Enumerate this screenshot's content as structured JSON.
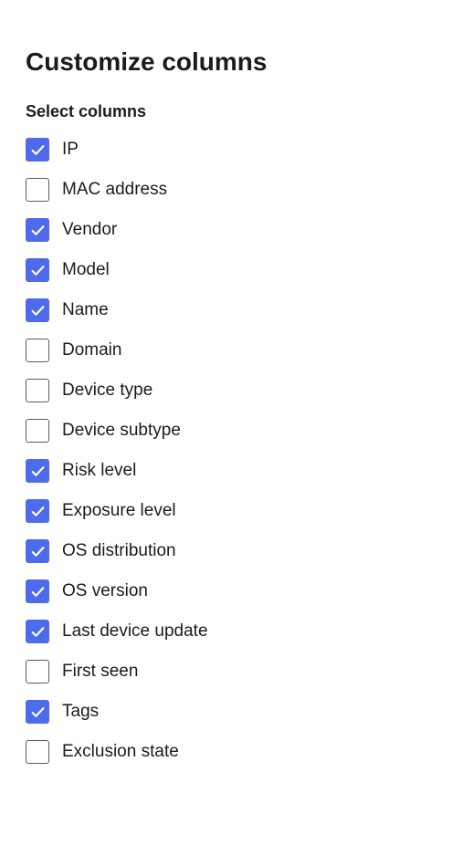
{
  "title": "Customize columns",
  "subtitle": "Select columns",
  "options": [
    {
      "label": "IP",
      "checked": true
    },
    {
      "label": "MAC address",
      "checked": false
    },
    {
      "label": "Vendor",
      "checked": true
    },
    {
      "label": "Model",
      "checked": true
    },
    {
      "label": "Name",
      "checked": true
    },
    {
      "label": "Domain",
      "checked": false
    },
    {
      "label": "Device type",
      "checked": false
    },
    {
      "label": "Device subtype",
      "checked": false
    },
    {
      "label": "Risk level",
      "checked": true
    },
    {
      "label": "Exposure level",
      "checked": true
    },
    {
      "label": "OS distribution",
      "checked": true
    },
    {
      "label": "OS version",
      "checked": true
    },
    {
      "label": "Last device update",
      "checked": true
    },
    {
      "label": "First seen",
      "checked": false
    },
    {
      "label": "Tags",
      "checked": true
    },
    {
      "label": "Exclusion state",
      "checked": false
    }
  ]
}
